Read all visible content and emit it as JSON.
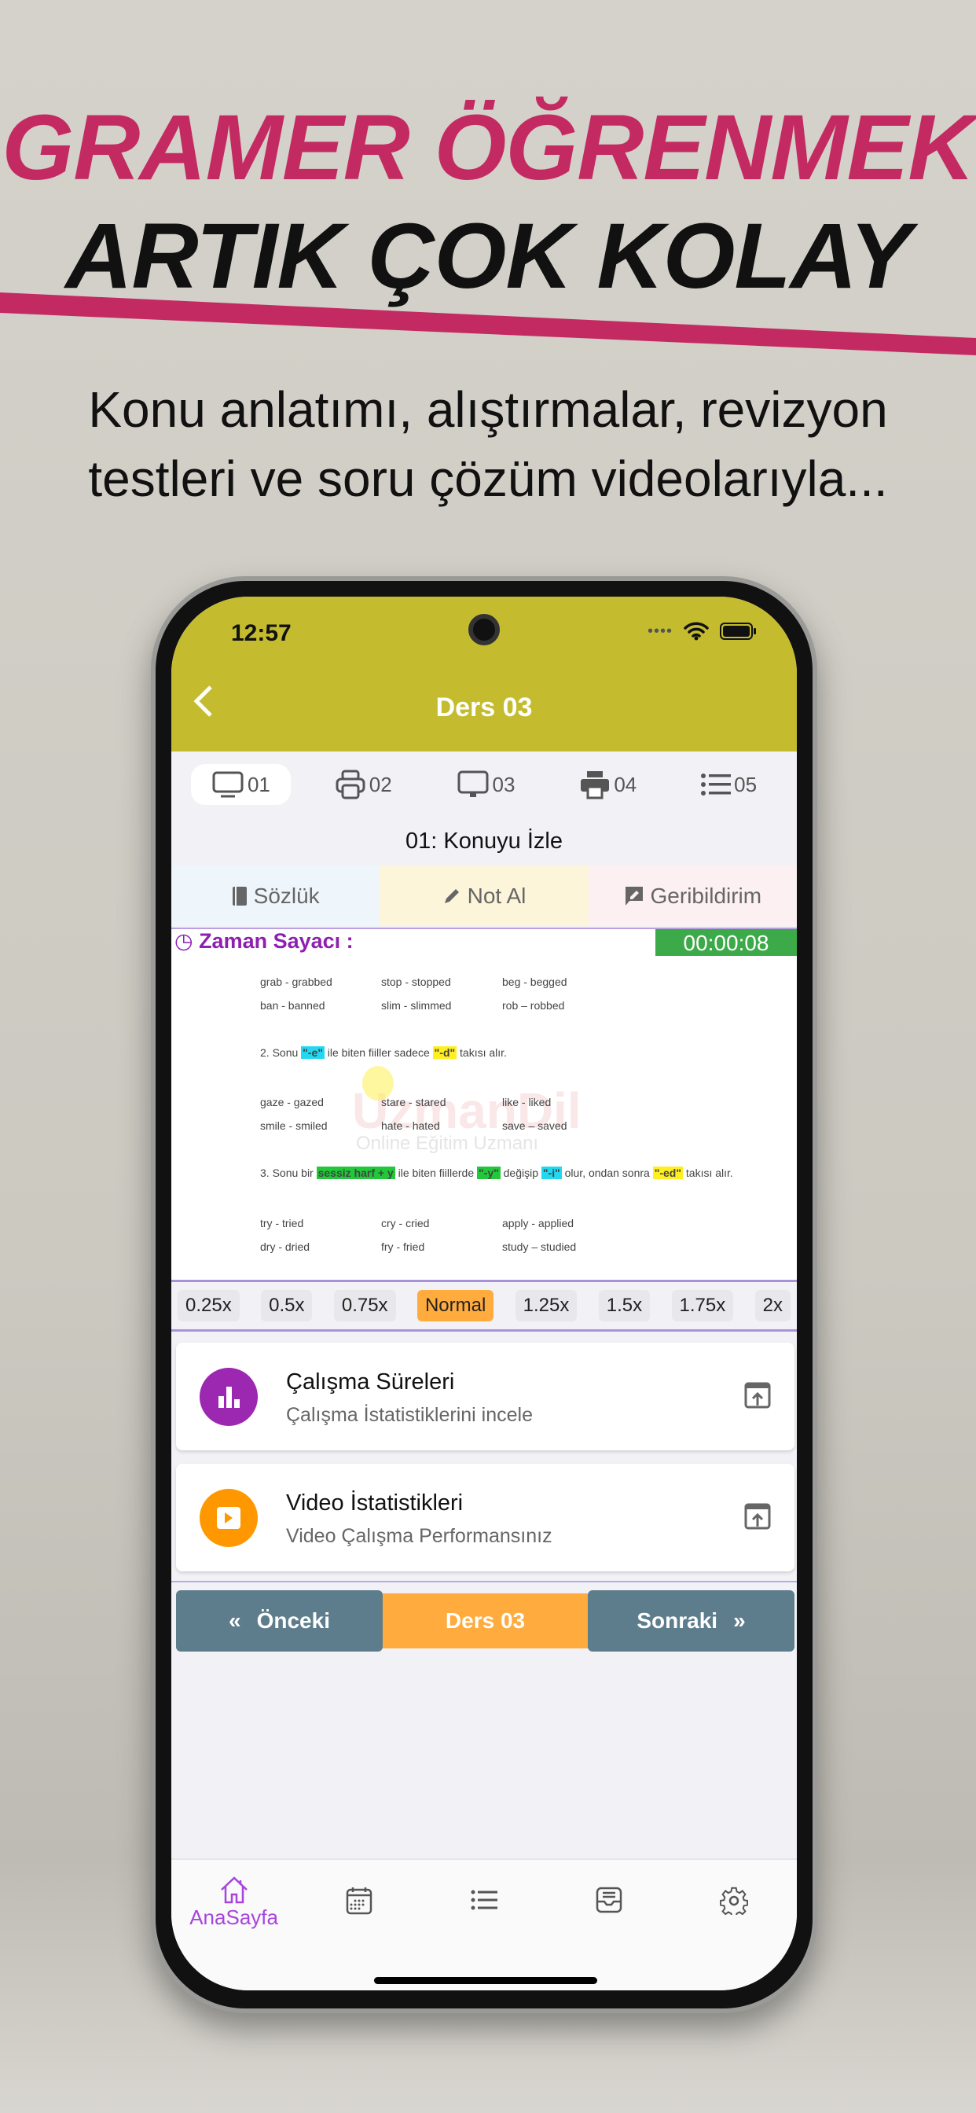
{
  "promo": {
    "headline1": "GRAMER ÖĞRENMEK",
    "headline2": "ARTIK ÇOK KOLAY",
    "subtitle1": "Konu anlatımı, alıştırmalar, revizyon",
    "subtitle2": "testleri ve soru çözüm videolarıyla...",
    "accent": "#c42a62"
  },
  "status": {
    "time": "12:57"
  },
  "header": {
    "title": "Ders 03",
    "back_icon": "chevron-left",
    "color": "#c4bc2e"
  },
  "tabs": [
    {
      "label": "01",
      "icon": "monitor"
    },
    {
      "label": "02",
      "icon": "printer-outline"
    },
    {
      "label": "03",
      "icon": "desktop"
    },
    {
      "label": "04",
      "icon": "printer"
    },
    {
      "label": "05",
      "icon": "list"
    }
  ],
  "section_title": "01: Konuyu İzle",
  "actions": [
    {
      "label": "Sözlük",
      "icon": "book"
    },
    {
      "label": "Not Al",
      "icon": "pencil"
    },
    {
      "label": "Geribildirim",
      "icon": "feedback"
    }
  ],
  "timer": {
    "label": "Zaman Sayacı :",
    "value": "00:00:08"
  },
  "video": {
    "rows1": [
      [
        "grab - grabbed",
        "stop - stopped",
        "beg - begged"
      ],
      [
        "ban - banned",
        "slim - slimmed",
        "rob – robbed"
      ]
    ],
    "rule2": {
      "a": "2. Sonu ",
      "h1": "\"-e\"",
      "b": " ile biten fiiller sadece ",
      "h2": "\"-d\"",
      "c": " takısı alır."
    },
    "rows2": [
      [
        "gaze - gazed",
        "stare - stared",
        "like - liked"
      ],
      [
        "smile - smiled",
        "hate - hated",
        "save – saved"
      ]
    ],
    "rule3": {
      "a": "3. Sonu bir ",
      "h1": "sessiz harf + y",
      "b": " ile biten fiillerde ",
      "h2": "\"-y\"",
      "c": " değişip ",
      "h3": "\"-i\"",
      "d": " olur, ondan sonra ",
      "h4": "\"-ed\"",
      "e": " takısı alır."
    },
    "rows3": [
      [
        "try - tried",
        "cry - cried",
        "apply - applied"
      ],
      [
        "dry - dried",
        "fry - fried",
        "study – studied"
      ]
    ],
    "watermark1": "UzmanDil",
    "watermark2": "Online Eğitim Uzmanı"
  },
  "speeds": [
    "0.25x",
    "0.5x",
    "0.75x",
    "Normal",
    "1.25x",
    "1.5x",
    "1.75x",
    "2x"
  ],
  "selected_speed": "Normal",
  "cards": [
    {
      "title": "Çalışma Süreleri",
      "subtitle": "Çalışma İstatistiklerini incele",
      "icon": "bar-chart",
      "color": "#9c27b0"
    },
    {
      "title": "Video İstatistikleri",
      "subtitle": "Video Çalışma Performansınız",
      "icon": "play",
      "color": "#ff9800"
    }
  ],
  "lesson_nav": {
    "prev": "Önceki",
    "current": "Ders 03",
    "next": "Sonraki"
  },
  "bottom_nav": [
    {
      "label": "AnaSayfa",
      "icon": "home",
      "active": true
    },
    {
      "label": "",
      "icon": "calendar"
    },
    {
      "label": "",
      "icon": "list"
    },
    {
      "label": "",
      "icon": "inbox"
    },
    {
      "label": "",
      "icon": "gear"
    }
  ]
}
